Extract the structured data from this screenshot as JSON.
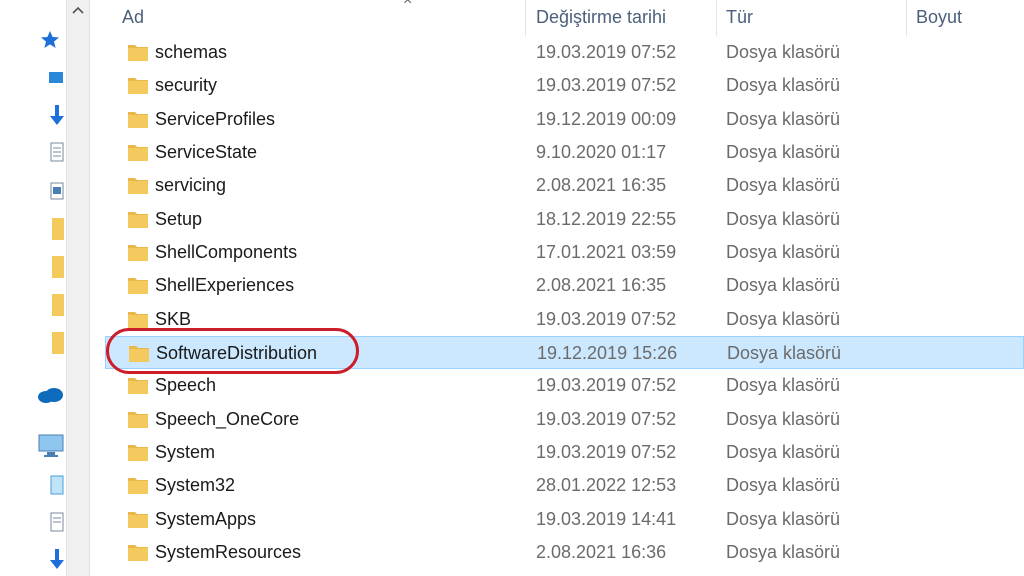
{
  "header": {
    "name_label": "Ad",
    "date_label": "Değiştirme tarihi",
    "type_label": "Tür",
    "size_label": "Boyut"
  },
  "rows": [
    {
      "name": "schemas",
      "date": "19.03.2019 07:52",
      "type": "Dosya klasörü"
    },
    {
      "name": "security",
      "date": "19.03.2019 07:52",
      "type": "Dosya klasörü"
    },
    {
      "name": "ServiceProfiles",
      "date": "19.12.2019 00:09",
      "type": "Dosya klasörü"
    },
    {
      "name": "ServiceState",
      "date": "9.10.2020 01:17",
      "type": "Dosya klasörü"
    },
    {
      "name": "servicing",
      "date": "2.08.2021 16:35",
      "type": "Dosya klasörü"
    },
    {
      "name": "Setup",
      "date": "18.12.2019 22:55",
      "type": "Dosya klasörü"
    },
    {
      "name": "ShellComponents",
      "date": "17.01.2021 03:59",
      "type": "Dosya klasörü"
    },
    {
      "name": "ShellExperiences",
      "date": "2.08.2021 16:35",
      "type": "Dosya klasörü"
    },
    {
      "name": "SKB",
      "date": "19.03.2019 07:52",
      "type": "Dosya klasörü"
    },
    {
      "name": "SoftwareDistribution",
      "date": "19.12.2019 15:26",
      "type": "Dosya klasörü",
      "selected": true
    },
    {
      "name": "Speech",
      "date": "19.03.2019 07:52",
      "type": "Dosya klasörü"
    },
    {
      "name": "Speech_OneCore",
      "date": "19.03.2019 07:52",
      "type": "Dosya klasörü"
    },
    {
      "name": "System",
      "date": "19.03.2019 07:52",
      "type": "Dosya klasörü"
    },
    {
      "name": "System32",
      "date": "28.01.2022 12:53",
      "type": "Dosya klasörü"
    },
    {
      "name": "SystemApps",
      "date": "19.03.2019 14:41",
      "type": "Dosya klasörü"
    },
    {
      "name": "SystemResources",
      "date": "2.08.2021 16:36",
      "type": "Dosya klasörü"
    }
  ],
  "colors": {
    "selection_bg": "#cce8ff",
    "selection_border": "#99d1ff",
    "annotation": "#cc1d2b",
    "folder": "#f4c95d"
  },
  "icons": {
    "folder": "folder-icon",
    "scroll_up": "chevron-up-icon"
  }
}
